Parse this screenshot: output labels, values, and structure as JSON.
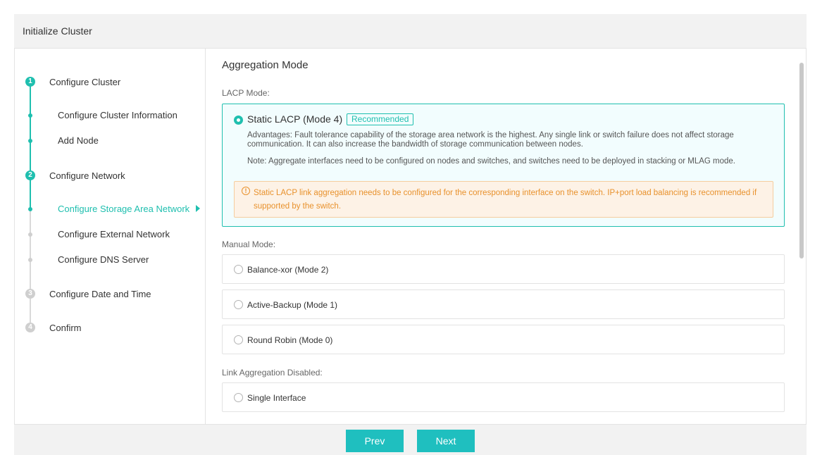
{
  "window": {
    "title": "Initialize Cluster"
  },
  "sidebar": {
    "steps": [
      {
        "number": "1",
        "label": "Configure Cluster",
        "state": "active"
      },
      {
        "number": "2",
        "label": "Configure Network",
        "state": "active"
      },
      {
        "number": "3",
        "label": "Configure Date and Time",
        "state": "inactive"
      },
      {
        "number": "4",
        "label": "Confirm",
        "state": "inactive"
      }
    ],
    "substeps": [
      {
        "label": "Configure Cluster Information"
      },
      {
        "label": "Add Node"
      },
      {
        "label": "Configure Storage Area Network",
        "current": true
      },
      {
        "label": "Configure External Network"
      },
      {
        "label": "Configure DNS Server"
      }
    ]
  },
  "main": {
    "section_title": "Aggregation Mode",
    "lacp_label": "LACP Mode:",
    "lacp_option": {
      "label": "Static LACP (Mode 4)",
      "badge": "Recommended",
      "selected": true,
      "advantages": "Advantages: Fault tolerance capability of the storage area network is the highest. Any single link or switch failure does not affect storage communication. It can also increase the bandwidth of storage communication between nodes.",
      "note": "Note: Aggregate interfaces need to be configured on nodes and switches, and switches need to be deployed in stacking or MLAG mode.",
      "warning": "Static LACP link aggregation needs to be configured for the corresponding interface on the switch. IP+port load balancing is recommended if supported by the switch."
    },
    "manual_label": "Manual Mode:",
    "manual_options": [
      {
        "label": "Balance-xor (Mode 2)",
        "selected": false
      },
      {
        "label": "Active-Backup (Mode 1)",
        "selected": false
      },
      {
        "label": "Round Robin (Mode 0)",
        "selected": false
      }
    ],
    "disabled_label": "Link Aggregation Disabled:",
    "disabled_options": [
      {
        "label": "Single Interface",
        "selected": false
      }
    ]
  },
  "footer": {
    "prev_label": "Prev",
    "next_label": "Next"
  },
  "colors": {
    "accent": "#1fbfaf",
    "warning": "#e8912c",
    "warning_bg": "#fdf2e6"
  }
}
